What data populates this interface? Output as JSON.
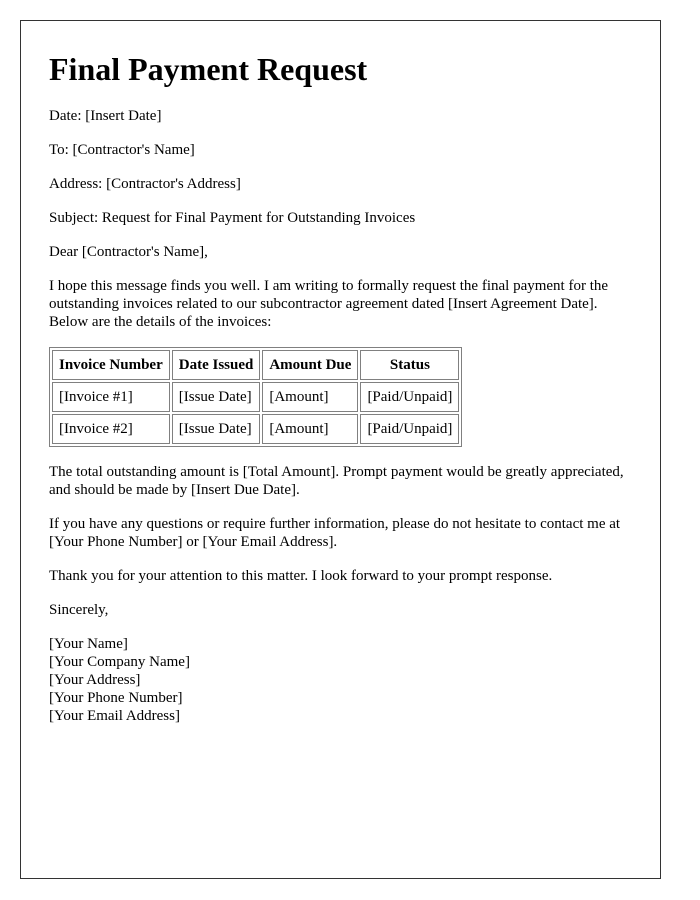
{
  "title": "Final Payment Request",
  "fields": {
    "date": "Date: [Insert Date]",
    "to": "To: [Contractor's Name]",
    "address": "Address: [Contractor's Address]",
    "subject": "Subject: Request for Final Payment for Outstanding Invoices"
  },
  "salutation": "Dear [Contractor's Name],",
  "intro": "I hope this message finds you well. I am writing to formally request the final payment for the outstanding invoices related to our subcontractor agreement dated [Insert Agreement Date]. Below are the details of the invoices:",
  "table": {
    "headers": [
      "Invoice Number",
      "Date Issued",
      "Amount Due",
      "Status"
    ],
    "rows": [
      [
        "[Invoice #1]",
        "[Issue Date]",
        "[Amount]",
        "[Paid/Unpaid]"
      ],
      [
        "[Invoice #2]",
        "[Issue Date]",
        "[Amount]",
        "[Paid/Unpaid]"
      ]
    ]
  },
  "total_paragraph": "The total outstanding amount is [Total Amount]. Prompt payment would be greatly appreciated, and should be made by [Insert Due Date].",
  "questions_paragraph": "If you have any questions or require further information, please do not hesitate to contact me at [Your Phone Number] or [Your Email Address].",
  "thanks_paragraph": "Thank you for your attention to this matter. I look forward to your prompt response.",
  "closing": "Sincerely,",
  "signature": [
    "[Your Name]",
    "[Your Company Name]",
    "[Your Address]",
    "[Your Phone Number]",
    "[Your Email Address]"
  ]
}
